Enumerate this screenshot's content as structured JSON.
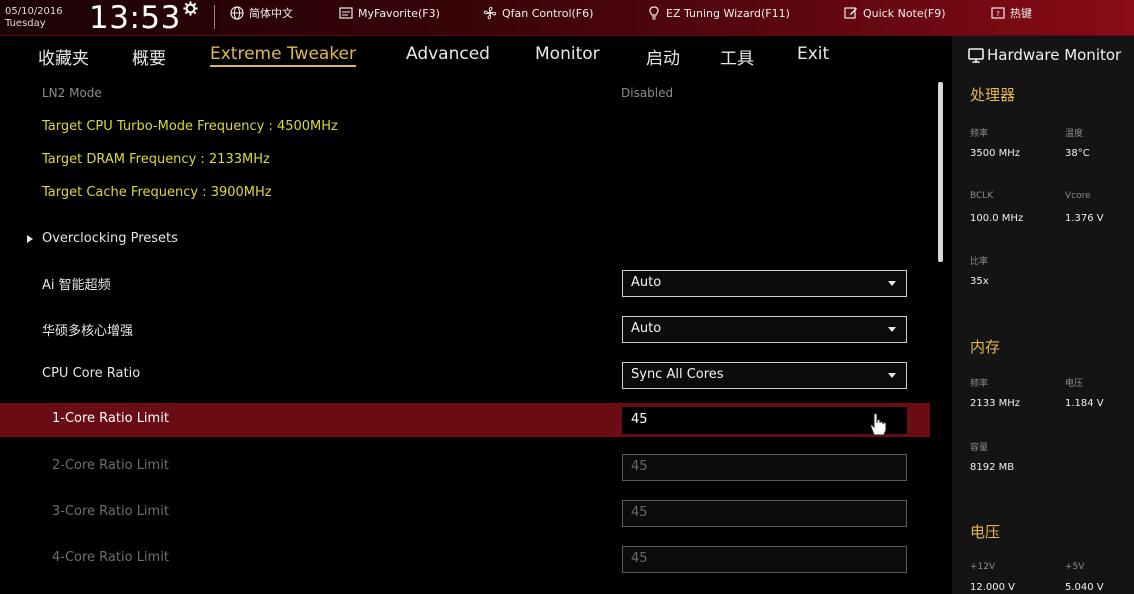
{
  "topbar": {
    "date": "05/10/2016",
    "weekday": "Tuesday",
    "time": "13:53",
    "items": [
      {
        "label": "简体中文",
        "icon": "globe-icon"
      },
      {
        "label": "MyFavorite(F3)",
        "icon": "favorite-icon"
      },
      {
        "label": "Qfan Control(F6)",
        "icon": "fan-icon"
      },
      {
        "label": "EZ Tuning Wizard(F11)",
        "icon": "bulb-icon"
      },
      {
        "label": "Quick Note(F9)",
        "icon": "note-icon"
      },
      {
        "label": "热键",
        "icon": "hotkey-icon"
      }
    ]
  },
  "nav": {
    "tabs": [
      {
        "label": "收藏夹"
      },
      {
        "label": "概要"
      },
      {
        "label": "Extreme Tweaker",
        "active": true
      },
      {
        "label": "Advanced"
      },
      {
        "label": "Monitor"
      },
      {
        "label": "启动"
      },
      {
        "label": "工具"
      },
      {
        "label": "Exit"
      }
    ]
  },
  "settings": {
    "ln2_label": "LN2 Mode",
    "ln2_value": "Disabled",
    "target_cpu": "Target CPU Turbo-Mode Frequency : 4500MHz",
    "target_dram": "Target DRAM Frequency : 2133MHz",
    "target_cache": "Target Cache Frequency : 3900MHz",
    "oc_presets": "Overclocking Presets",
    "ai_label": "Ai 智能超频",
    "ai_value": "Auto",
    "asus_mce_label": "华硕多核心增强",
    "asus_mce_value": "Auto",
    "cpu_ratio_label": "CPU Core Ratio",
    "cpu_ratio_value": "Sync All Cores",
    "core1_label": "1-Core Ratio Limit",
    "core1_value": "45",
    "core2_label": "2-Core Ratio Limit",
    "core2_value": "45",
    "core3_label": "3-Core Ratio Limit",
    "core3_value": "45",
    "core4_label": "4-Core Ratio Limit",
    "core4_value": "45"
  },
  "hw": {
    "title": "Hardware Monitor",
    "cpu_title": "处理器",
    "freq_label": "频率",
    "freq_value": "3500 MHz",
    "temp_label": "温度",
    "temp_value": "38°C",
    "bclk_label": "BCLK",
    "bclk_value": "100.0 MHz",
    "vcore_label": "Vcore",
    "vcore_value": "1.376 V",
    "ratio_label": "比率",
    "ratio_value": "35x",
    "mem_title": "内存",
    "mem_freq_label": "频率",
    "mem_freq_value": "2133 MHz",
    "mem_volt_label": "电压",
    "mem_volt_value": "1.184 V",
    "mem_cap_label": "容量",
    "mem_cap_value": "8192 MB",
    "volt_title": "电压",
    "v12_label": "+12V",
    "v12_value": "12.000 V",
    "v5_label": "+5V",
    "v5_value": "5.040 V"
  }
}
